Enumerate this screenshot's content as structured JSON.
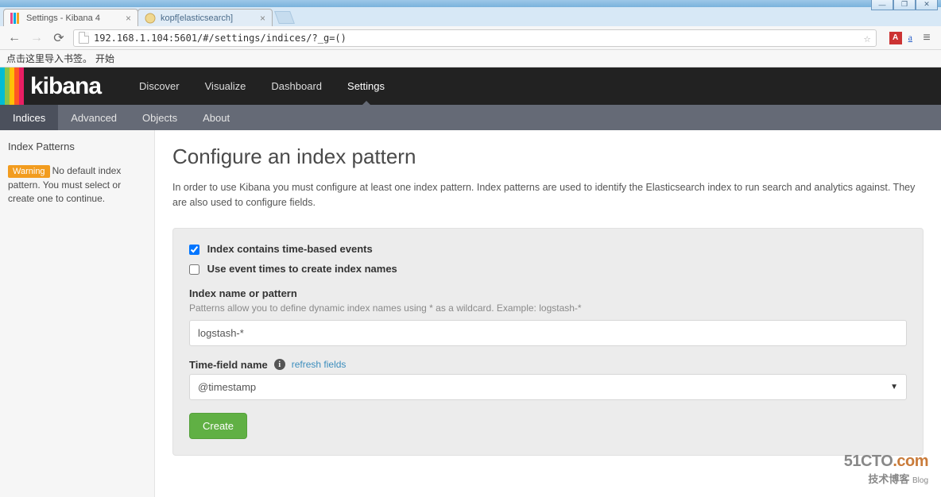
{
  "browser": {
    "tabs": [
      {
        "title": "Settings - Kibana 4",
        "active": true
      },
      {
        "title": "kopf[elasticsearch]",
        "active": false
      }
    ],
    "url": "192.168.1.104:5601/#/settings/indices/?_g=()",
    "bookmark_hint": "点击这里导入书签。",
    "start": "开始"
  },
  "win": {
    "min": "—",
    "max": "❐",
    "close": "✕"
  },
  "logo_text": "kibana",
  "stripes": [
    "#00bcd4",
    "#8bc34a",
    "#ffc107",
    "#ff5722",
    "#e91e63"
  ],
  "topnav": [
    {
      "label": "Discover"
    },
    {
      "label": "Visualize"
    },
    {
      "label": "Dashboard"
    },
    {
      "label": "Settings",
      "active": true
    }
  ],
  "subnav": [
    {
      "label": "Indices",
      "active": true
    },
    {
      "label": "Advanced"
    },
    {
      "label": "Objects"
    },
    {
      "label": "About"
    }
  ],
  "sidebar": {
    "heading": "Index Patterns",
    "warning_badge": "Warning",
    "warning_text": "No default index pattern. You must select or create one to continue."
  },
  "main": {
    "title": "Configure an index pattern",
    "description": "In order to use Kibana you must configure at least one index pattern. Index patterns are used to identify the Elasticsearch index to run search and analytics against. They are also used to configure fields.",
    "check1": "Index contains time-based events",
    "check2": "Use event times to create index names",
    "index_label": "Index name or pattern",
    "index_hint": "Patterns allow you to define dynamic index names using * as a wildcard. Example: logstash-*",
    "index_value": "logstash-*",
    "time_label": "Time-field name",
    "refresh": "refresh fields",
    "time_value": "@timestamp",
    "create": "Create"
  },
  "watermark": {
    "brand": "51CTO",
    "suffix": ".com",
    "sub": "技术博客",
    "blog": "Blog"
  }
}
